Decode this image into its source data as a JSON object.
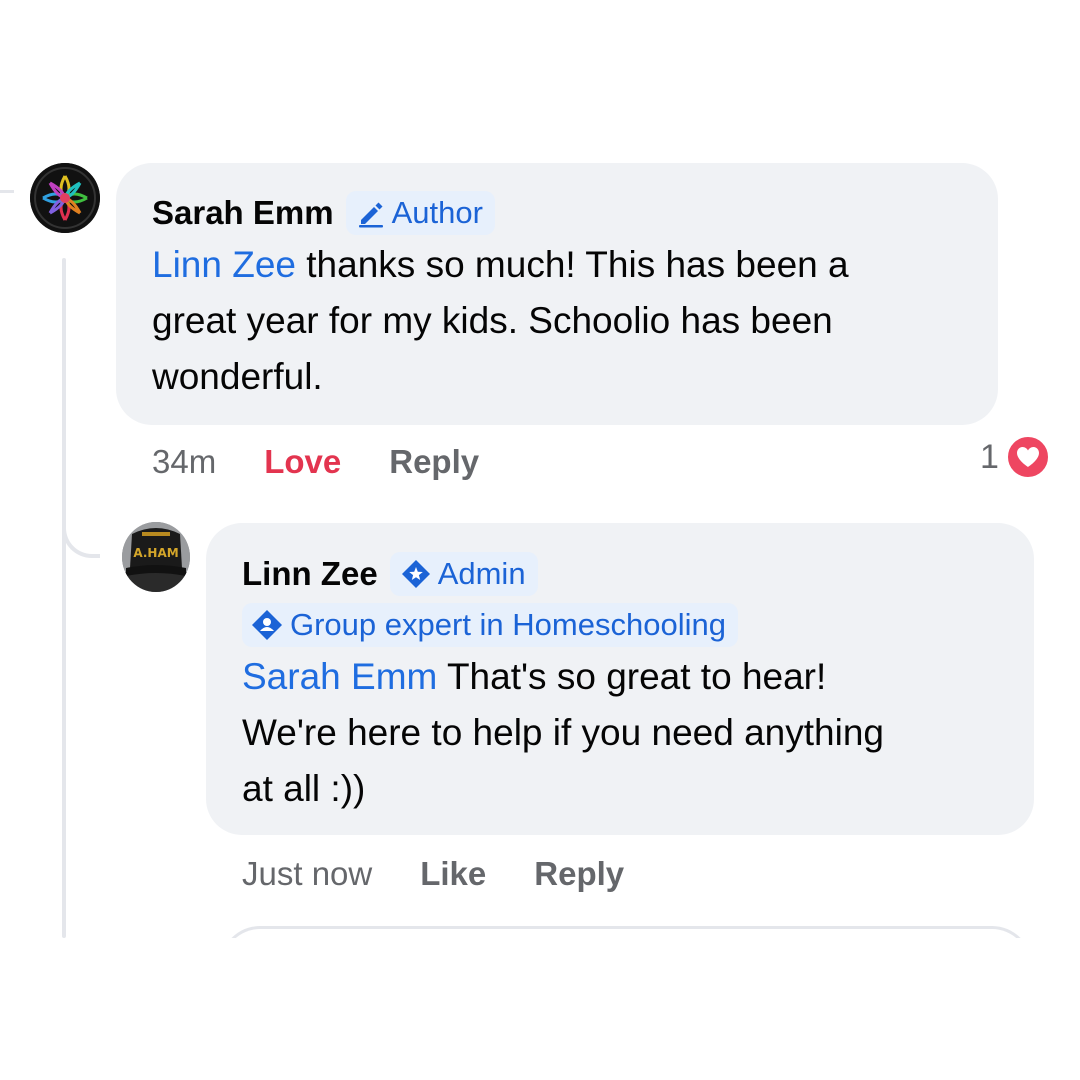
{
  "comments": [
    {
      "author": "Sarah Emm",
      "badge": "Author",
      "badge_icon": "pencil-icon",
      "mention": "Linn Zee",
      "text_line1": " thanks so much! This has been a",
      "text_line2": "great year for my kids. Schoolio has been",
      "text_line3": "wonderful.",
      "time": "34m",
      "reaction_label": "Love",
      "reply_label": "Reply",
      "reaction_count": "1",
      "reaction_icon": "heart-icon"
    },
    {
      "author": "Linn Zee",
      "badge": "Admin",
      "badge_icon": "admin-star-icon",
      "expert_badge": "Group expert in Homeschooling",
      "expert_icon": "expert-icon",
      "mention": "Sarah Emm",
      "text_line1": " That's so great to hear!",
      "text_line2": "We're here to help if you need anything",
      "text_line3": "at all :))",
      "time": "Just now",
      "like_label": "Like",
      "reply_label": "Reply"
    }
  ],
  "colors": {
    "mention": "#1f6de0",
    "badge_text": "#1b63d6",
    "badge_bg": "#e7f0fc",
    "bubble": "#f0f2f5",
    "love": "#e3344f",
    "heart": "#ee4661",
    "meta": "#65676b"
  }
}
